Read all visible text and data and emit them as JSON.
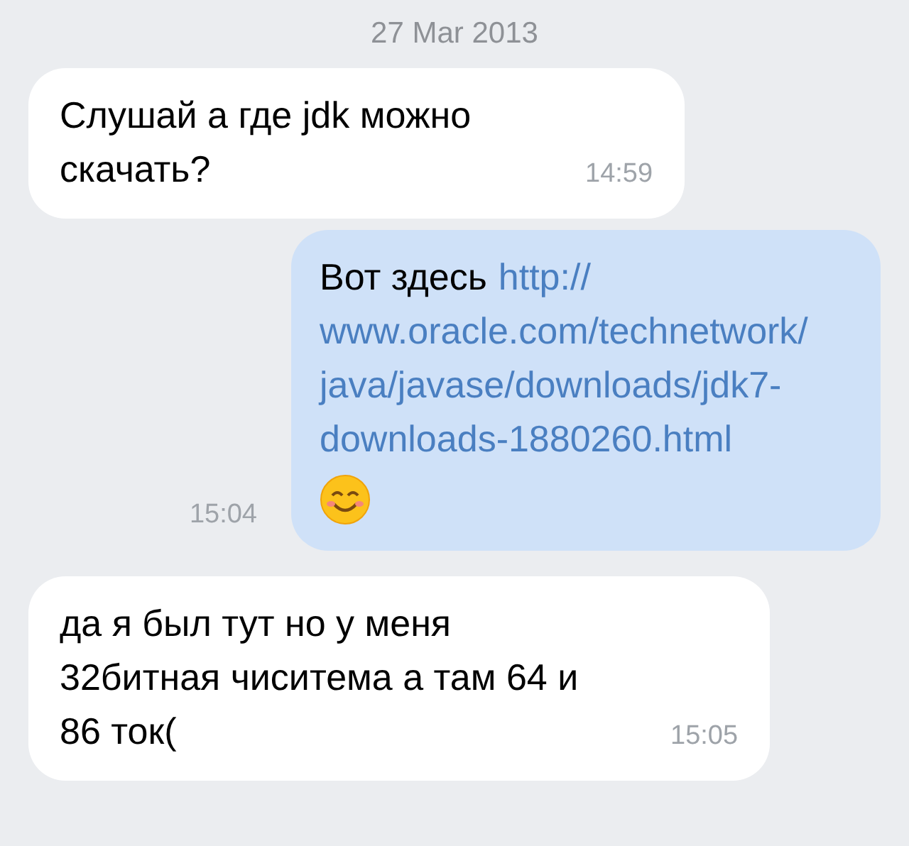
{
  "date": "27 Mar 2013",
  "messages": [
    {
      "kind": "incoming",
      "text": "Слушай а где jdk можно скачать?",
      "time": "14:59"
    },
    {
      "kind": "outgoing",
      "text": "Вот здесь",
      "link": "http://www.oracle.com/technetwork/java/javase/downloads/jdk7-downloads-1880260.html",
      "emoji": true,
      "time": "15:04"
    },
    {
      "kind": "incoming",
      "text": "да я был тут но у меня 32битная чиситема а там 64 и 86 ток(",
      "time": "15:05"
    }
  ]
}
